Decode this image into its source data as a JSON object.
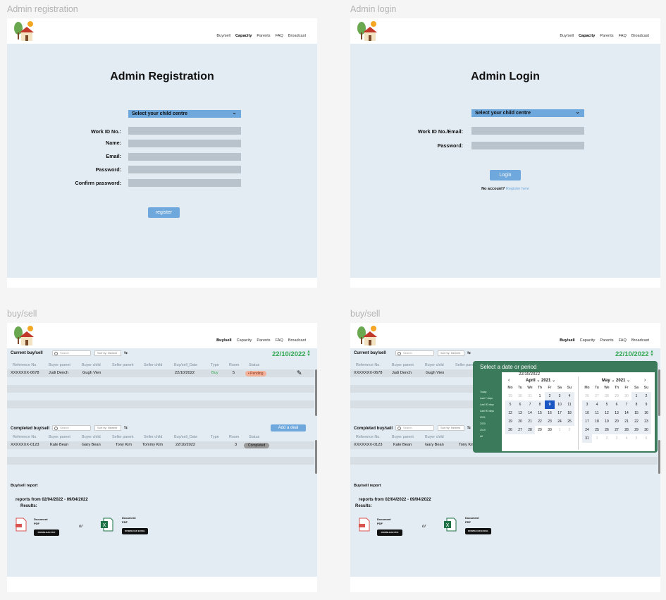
{
  "frames": {
    "reg_label": "Admin registration",
    "login_label": "Admin login",
    "bs_label": "buy/sell",
    "bs2_label": "buy/sell"
  },
  "nav": {
    "items": [
      "Buy/sell",
      "Capacity",
      "Parents",
      "FAQ",
      "Broadcast"
    ]
  },
  "registration": {
    "title": "Admin Registration",
    "dropdown": "Select your child centre",
    "fields": [
      "Work ID No.:",
      "Name:",
      "Email:",
      "Password:",
      "Confirm password:"
    ],
    "button": "register"
  },
  "login": {
    "title": "Admin Login",
    "dropdown": "Select your child centre",
    "fields": [
      "Work ID No./Email:",
      "Password:"
    ],
    "button": "Login",
    "no_account": "No account?",
    "register_link": "Register here"
  },
  "buysell": {
    "current_title": "Current buy/sell",
    "completed_title": "Completed buy/sell",
    "search_placeholder": "Search",
    "sort_label": "Sort by: Newest",
    "date": "22/10/2022",
    "add_deal": "Add a deal",
    "headers": [
      "Reference No.",
      "Buyer parent",
      "Buyer child",
      "Seller parent",
      "Seller child",
      "Buy/sell_Date",
      "Type",
      "Room",
      "Status"
    ],
    "current_row": [
      "XXXXXXX-0678",
      "Judi Dench",
      "Gugh Vien",
      "",
      "",
      "22/10/2022",
      "Buy",
      "5",
      "Pending"
    ],
    "completed_row": [
      "XXXXXXX-0123",
      "Kate Bean",
      "Gary Bean",
      "Tony Kim",
      "Tommy Kim",
      "22/10/2022",
      "",
      "3",
      "Completed"
    ],
    "report_title": "Buy/sell report",
    "report_range": "reports from 02/04/2022 - 09/04/2022",
    "results": "Results:",
    "pdf_doc_title": "Document",
    "pdf_doc_type": "PDF",
    "pdf_button": "DOWNLOAD PDF",
    "or": "or",
    "excel_doc_title": "Document",
    "excel_doc_type": "PDF",
    "excel_button": "DOWNLOAD EXCEL"
  },
  "datepicker": {
    "title": "Select a date or period",
    "selected_date": "22/10/2022",
    "presets": [
      "Today",
      "Last 7 days",
      "Last 30 days",
      "Last 90 days",
      "2021",
      "2020",
      "2019",
      "All"
    ],
    "left_month": "April",
    "left_year": "2021",
    "right_month": "May",
    "right_year": "2021",
    "weekdays": [
      "Mo",
      "Tu",
      "We",
      "Th",
      "Fr",
      "Sa",
      "Su"
    ],
    "left_days": [
      "29",
      "30",
      "31",
      "1",
      "2",
      "3",
      "4",
      "5",
      "6",
      "7",
      "8",
      "9",
      "10",
      "11",
      "12",
      "13",
      "14",
      "15",
      "16",
      "17",
      "18",
      "19",
      "20",
      "21",
      "22",
      "23",
      "24",
      "25",
      "26",
      "27",
      "28",
      "29",
      "30",
      "1",
      "2"
    ],
    "right_days": [
      "26",
      "27",
      "28",
      "29",
      "30",
      "1",
      "2",
      "3",
      "4",
      "5",
      "6",
      "7",
      "8",
      "9",
      "10",
      "11",
      "12",
      "13",
      "14",
      "15",
      "16",
      "17",
      "18",
      "19",
      "20",
      "21",
      "22",
      "23",
      "24",
      "25",
      "26",
      "27",
      "28",
      "29",
      "30",
      "31",
      "1",
      "2",
      "3",
      "4",
      "5",
      "6"
    ]
  },
  "colors": {
    "accent": "#6fa8dc",
    "panel": "#e3ecf3",
    "date_green": "#34a853",
    "picker_green": "#3b7a5a",
    "selected_day": "#1a56c4"
  }
}
